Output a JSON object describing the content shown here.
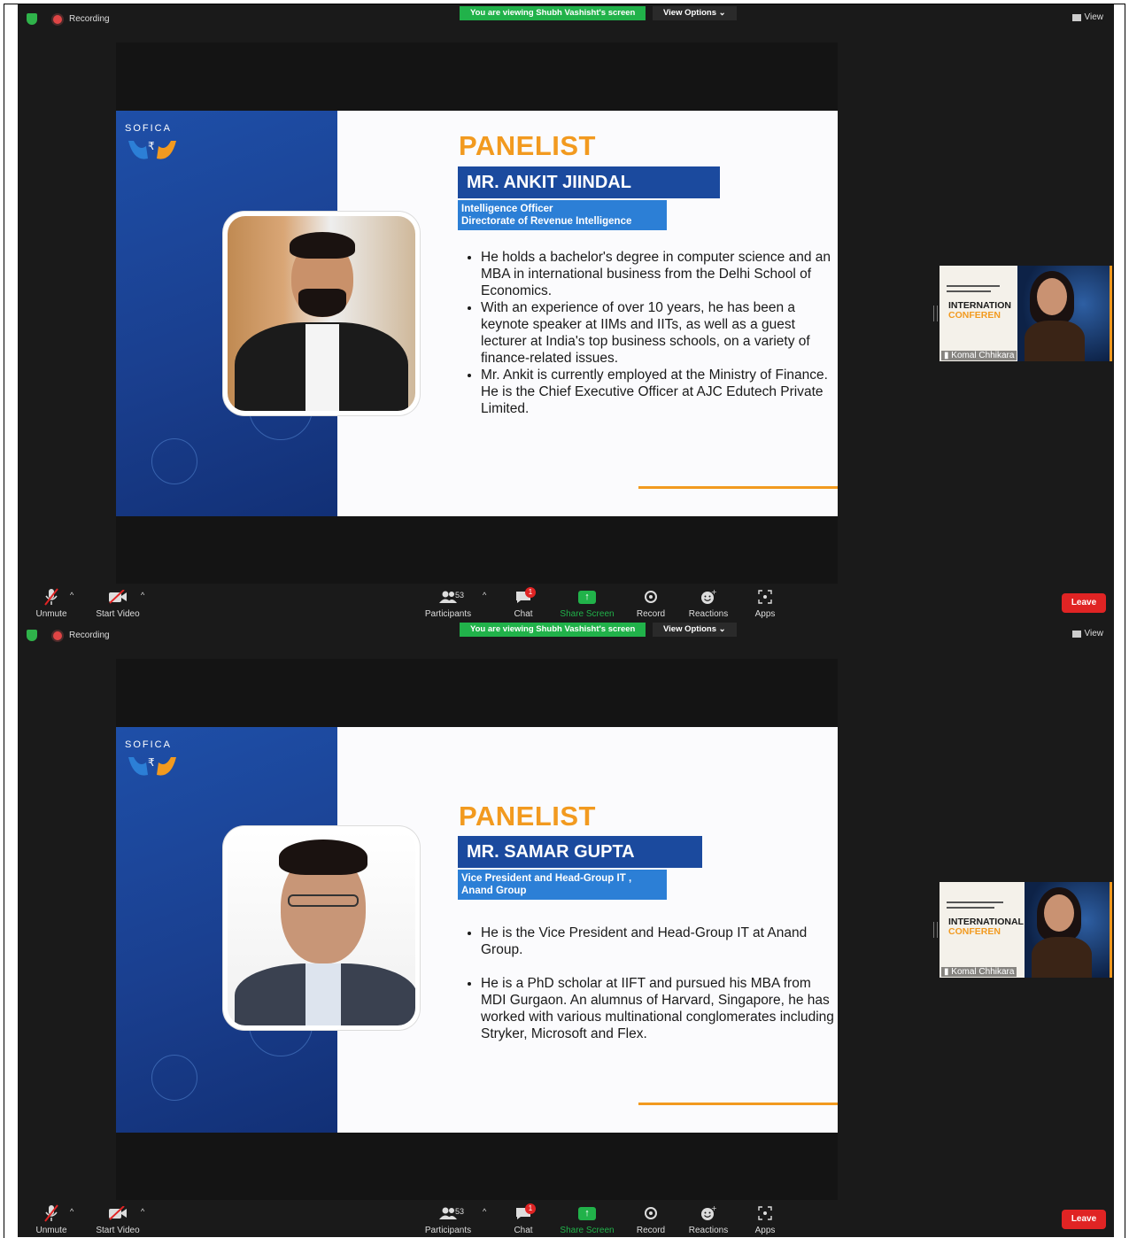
{
  "meetings": [
    {
      "recording_label": "Recording",
      "viewing_label": "You are viewing Shubh Vashisht's screen",
      "view_options_label": "View Options ⌄",
      "view_label": "View",
      "slide": {
        "logo_text": "SOFICA",
        "title": "PANELIST",
        "name": "MR. ANKIT JIINDAL",
        "role_line1": "Intelligence Officer",
        "role_line2": "Directorate of Revenue Intelligence",
        "bullets": [
          "He holds a bachelor's degree in computer science and an MBA in international business from the Delhi School of Economics.",
          "With an experience of over 10 years, he has been a keynote speaker at IIMs and IITs, as well as a guest lecturer at India's top business schools, on a variety of finance-related issues.",
          "Mr. Ankit is currently employed at the Ministry of Finance. He is the Chief Executive Officer at AJC Edutech Private Limited."
        ]
      },
      "thumbnail": {
        "poster_title1": "INTERNATION",
        "poster_title2": "CONFEREN",
        "participant_name": "Komal Chhikara"
      },
      "toolbar": {
        "unmute": "Unmute",
        "start_video": "Start Video",
        "participants": "Participants",
        "participants_count": "53",
        "chat": "Chat",
        "chat_badge": "1",
        "share_screen": "Share Screen",
        "record": "Record",
        "reactions": "Reactions",
        "apps": "Apps",
        "leave": "Leave"
      }
    },
    {
      "recording_label": "Recording",
      "viewing_label": "You are viewing Shubh Vashisht's screen",
      "view_options_label": "View Options ⌄",
      "view_label": "View",
      "slide": {
        "logo_text": "SOFICA",
        "title": "PANELIST",
        "name": "MR. SAMAR GUPTA",
        "role_line1": "Vice President and Head-Group IT ,",
        "role_line2": "Anand Group",
        "bullets": [
          "He is the Vice President and Head-Group IT at Anand Group.",
          "He is a PhD scholar at IIFT and pursued his MBA from MDI Gurgaon. An alumnus of Harvard, Singapore, he has worked with various multinational conglomerates including Stryker, Microsoft and Flex."
        ]
      },
      "thumbnail": {
        "poster_title1": "INTERNATIONAL",
        "poster_title2": "CONFEREN",
        "participant_name": "Komal Chhikara"
      },
      "toolbar": {
        "unmute": "Unmute",
        "start_video": "Start Video",
        "participants": "Participants",
        "participants_count": "53",
        "chat": "Chat",
        "chat_badge": "1",
        "share_screen": "Share Screen",
        "record": "Record",
        "reactions": "Reactions",
        "apps": "Apps",
        "leave": "Leave"
      }
    }
  ],
  "colors": {
    "accent_orange": "#f29a1f",
    "slide_blue": "#1b4a9e",
    "share_green": "#21b24a",
    "leave_red": "#e02424"
  }
}
